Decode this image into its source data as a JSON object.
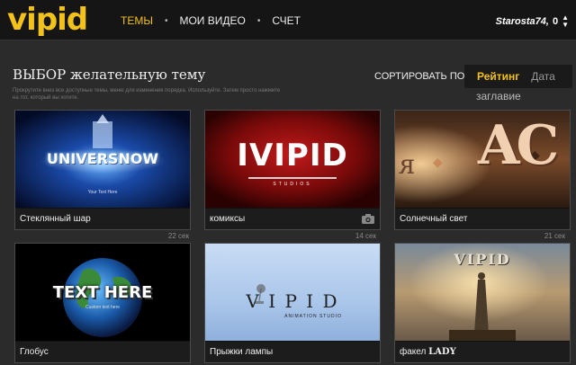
{
  "header": {
    "logo": "vipid",
    "nav": [
      {
        "label": "ТЕМЫ",
        "active": true
      },
      {
        "label": "МОИ ВИДЕО",
        "active": false
      },
      {
        "label": "СЧЕТ",
        "active": false
      }
    ],
    "user": {
      "name": "Starosta74,",
      "count": "0"
    }
  },
  "main": {
    "title": "ВЫБОР желательную тему",
    "subtitle": "Прокрутите вниз все доступные темы, меню для изменения порядка. Используйте. Затем просто нажмите на тот, который вы хотите.",
    "sort": {
      "label": "СОРТИРОВАТЬ ПО:",
      "active": "Рейтинг",
      "other": "Дата",
      "extra": "заглавие"
    }
  },
  "themes": [
    {
      "name": "Стеклянный шар",
      "duration": "22 сек",
      "thumb_text": "UNIVERSNOW",
      "thumb_sub": "Your Text Here"
    },
    {
      "name": "комиксы",
      "duration": "14 сек",
      "thumb_text": "IVIPID",
      "thumb_sub": "STUDIOS",
      "camera": true
    },
    {
      "name": "Солнечный свет",
      "duration": "21 сек",
      "thumb_text": "AC",
      "thumb_sub": ""
    },
    {
      "name": "Глобус",
      "duration": "",
      "thumb_text": "TEXT HERE",
      "thumb_sub": "Custom text here"
    },
    {
      "name": "Прыжки лампы",
      "duration": "",
      "thumb_text": "V I P I D",
      "thumb_sub": "ANIMATION STUDIO"
    },
    {
      "name": "факел",
      "name_suffix": "LADY",
      "duration": "",
      "thumb_text": "VIPID",
      "thumb_sub": ""
    }
  ],
  "colors": {
    "accent": "#f2c21b",
    "background": "#2b2b2b",
    "header": "#151515"
  }
}
